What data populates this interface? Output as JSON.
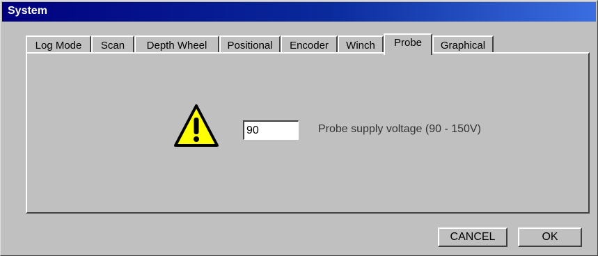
{
  "window": {
    "title": "System"
  },
  "tabs": [
    {
      "label": "Log Mode",
      "active": false
    },
    {
      "label": "Scan",
      "active": false
    },
    {
      "label": "Depth Wheel",
      "active": false
    },
    {
      "label": "Positional",
      "active": false
    },
    {
      "label": "Encoder",
      "active": false
    },
    {
      "label": "Winch",
      "active": false
    },
    {
      "label": "Probe",
      "active": true
    },
    {
      "label": "Graphical",
      "active": false
    }
  ],
  "probe_panel": {
    "icon": "warning-icon",
    "voltage_value": "90",
    "voltage_label": "Probe supply voltage (90 - 150V)"
  },
  "buttons": {
    "cancel_label": "CANCEL",
    "ok_label": "OK"
  },
  "colors": {
    "title_bar_start": "#00007e",
    "title_bar_end": "#3a6ee0",
    "warning_yellow": "#ffff00",
    "dialog_face": "#c0c0c0"
  }
}
